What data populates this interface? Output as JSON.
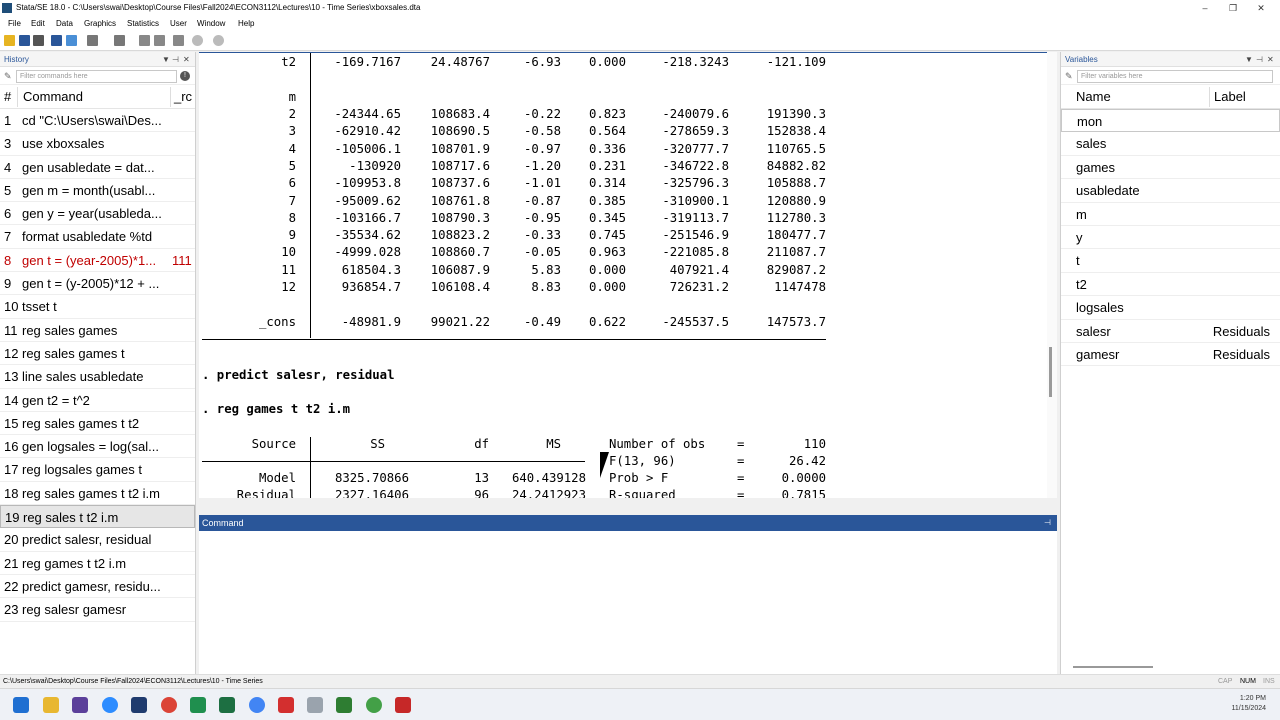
{
  "window": {
    "title": "Stata/SE 18.0 - C:\\Users\\swai\\Desktop\\Course Files\\Fall2024\\ECON3112\\Lectures\\10 - Time Series\\xboxsales.dta",
    "minimize": "–",
    "restore": "❐",
    "close": "✕"
  },
  "menu": [
    "File",
    "Edit",
    "Data",
    "Graphics",
    "Statistics",
    "User",
    "Window",
    "Help"
  ],
  "history": {
    "title": "History",
    "filter_placeholder": "Filter commands here",
    "col_num": "#",
    "col_command": "Command",
    "col_rc": "_rc",
    "items": [
      {
        "num": "1",
        "cmd": "cd \"C:\\Users\\swai\\Des...",
        "rc": ""
      },
      {
        "num": "3",
        "cmd": "use xboxsales",
        "rc": ""
      },
      {
        "num": "4",
        "cmd": "gen usabledate = dat...",
        "rc": ""
      },
      {
        "num": "5",
        "cmd": "gen m = month(usabl...",
        "rc": ""
      },
      {
        "num": "6",
        "cmd": "gen y = year(usableda...",
        "rc": ""
      },
      {
        "num": "7",
        "cmd": "format usabledate %td",
        "rc": ""
      },
      {
        "num": "8",
        "cmd": "gen t = (year-2005)*1...",
        "rc": "111"
      },
      {
        "num": "9",
        "cmd": "gen t = (y-2005)*12 + ...",
        "rc": ""
      },
      {
        "num": "10",
        "cmd": "tsset t",
        "rc": ""
      },
      {
        "num": "11",
        "cmd": "reg sales games",
        "rc": ""
      },
      {
        "num": "12",
        "cmd": "reg sales games t",
        "rc": ""
      },
      {
        "num": "13",
        "cmd": "line sales usabledate",
        "rc": ""
      },
      {
        "num": "14",
        "cmd": "gen t2 = t^2",
        "rc": ""
      },
      {
        "num": "15",
        "cmd": "reg sales games t t2",
        "rc": ""
      },
      {
        "num": "16",
        "cmd": "gen logsales = log(sal...",
        "rc": ""
      },
      {
        "num": "17",
        "cmd": "reg logsales games t",
        "rc": ""
      },
      {
        "num": "18",
        "cmd": "reg sales games t t2 i.m",
        "rc": ""
      },
      {
        "num": "19",
        "cmd": "reg sales t t2 i.m",
        "rc": ""
      },
      {
        "num": "20",
        "cmd": "predict salesr, residual",
        "rc": ""
      },
      {
        "num": "21",
        "cmd": "reg games t t2 i.m",
        "rc": ""
      },
      {
        "num": "22",
        "cmd": "predict gamesr, residu...",
        "rc": ""
      },
      {
        "num": "23",
        "cmd": "reg salesr gamesr",
        "rc": ""
      }
    ]
  },
  "results": {
    "t2_row": {
      "label": "t2",
      "coef": "-169.7167",
      "se": "24.48767",
      "t": "-6.93",
      "p": "0.000",
      "lo": "-218.3243",
      "hi": "-121.109"
    },
    "m_label": "m",
    "m_rows": [
      {
        "label": "2",
        "coef": "-24344.65",
        "se": "108683.4",
        "t": "-0.22",
        "p": "0.823",
        "lo": "-240079.6",
        "hi": "191390.3"
      },
      {
        "label": "3",
        "coef": "-62910.42",
        "se": "108690.5",
        "t": "-0.58",
        "p": "0.564",
        "lo": "-278659.3",
        "hi": "152838.4"
      },
      {
        "label": "4",
        "coef": "-105006.1",
        "se": "108701.9",
        "t": "-0.97",
        "p": "0.336",
        "lo": "-320777.7",
        "hi": "110765.5"
      },
      {
        "label": "5",
        "coef": "-130920",
        "se": "108717.6",
        "t": "-1.20",
        "p": "0.231",
        "lo": "-346722.8",
        "hi": "84882.82"
      },
      {
        "label": "6",
        "coef": "-109953.8",
        "se": "108737.6",
        "t": "-1.01",
        "p": "0.314",
        "lo": "-325796.3",
        "hi": "105888.7"
      },
      {
        "label": "7",
        "coef": "-95009.62",
        "se": "108761.8",
        "t": "-0.87",
        "p": "0.385",
        "lo": "-310900.1",
        "hi": "120880.9"
      },
      {
        "label": "8",
        "coef": "-103166.7",
        "se": "108790.3",
        "t": "-0.95",
        "p": "0.345",
        "lo": "-319113.7",
        "hi": "112780.3"
      },
      {
        "label": "9",
        "coef": "-35534.62",
        "se": "108823.2",
        "t": "-0.33",
        "p": "0.745",
        "lo": "-251546.9",
        "hi": "180477.7"
      },
      {
        "label": "10",
        "coef": "-4999.028",
        "se": "108860.7",
        "t": "-0.05",
        "p": "0.963",
        "lo": "-221085.8",
        "hi": "211087.7"
      },
      {
        "label": "11",
        "coef": "618504.3",
        "se": "106087.9",
        "t": "5.83",
        "p": "0.000",
        "lo": "407921.4",
        "hi": "829087.2"
      },
      {
        "label": "12",
        "coef": "936854.7",
        "se": "106108.4",
        "t": "8.83",
        "p": "0.000",
        "lo": "726231.2",
        "hi": "1147478"
      }
    ],
    "cons_row": {
      "label": "_cons",
      "coef": "-48981.9",
      "se": "99021.22",
      "t": "-0.49",
      "p": "0.622",
      "lo": "-245537.5",
      "hi": "147573.7"
    },
    "cmd1": ". predict salesr, residual",
    "cmd2": ". reg games t t2 i.m",
    "anova_header": {
      "source": "Source",
      "ss": "SS",
      "df": "df",
      "ms": "MS"
    },
    "stats": [
      {
        "label": "Number of obs",
        "eq": "=",
        "val": "110"
      },
      {
        "label": "F(13, 96)",
        "eq": "=",
        "val": "26.42"
      },
      {
        "label": "Prob > F",
        "eq": "=",
        "val": "0.0000"
      },
      {
        "label": "R-squared",
        "eq": "=",
        "val": "0.7815"
      }
    ],
    "model_row": {
      "label": "Model",
      "ss": "8325.70866",
      "df": "13",
      "ms": "640.439128"
    },
    "resid_row": {
      "label": "Residual",
      "ss": "2327.16406",
      "df": "96",
      "ms": "24.2412923"
    }
  },
  "command": {
    "title": "Command"
  },
  "variables": {
    "title": "Variables",
    "filter_placeholder": "Filter variables here",
    "col_name": "Name",
    "col_label": "Label",
    "items": [
      {
        "name": "mon",
        "label": ""
      },
      {
        "name": "sales",
        "label": ""
      },
      {
        "name": "games",
        "label": ""
      },
      {
        "name": "usabledate",
        "label": ""
      },
      {
        "name": "m",
        "label": ""
      },
      {
        "name": "y",
        "label": ""
      },
      {
        "name": "t",
        "label": ""
      },
      {
        "name": "t2",
        "label": ""
      },
      {
        "name": "logsales",
        "label": ""
      },
      {
        "name": "salesr",
        "label": "Residuals"
      },
      {
        "name": "gamesr",
        "label": "Residuals"
      }
    ]
  },
  "statusbar": {
    "path": "C:\\Users\\swai\\Desktop\\Course Files\\Fall2024\\ECON3112\\Lectures\\10 - Time Series",
    "cap": "CAP",
    "num": "NUM",
    "ins": "INS"
  },
  "clock": {
    "time": "1:20 PM",
    "date": "11/15/2024"
  }
}
